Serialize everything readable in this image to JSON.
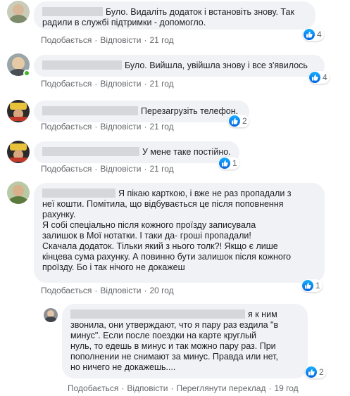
{
  "colors": {
    "bubble_bg": "#f0f2f5",
    "meta_text": "#65676b",
    "like_blue": "#1877f2",
    "online_green": "#42b72a"
  },
  "comments": [
    {
      "text": "Було. Видаліть додаток і встановіть знову. Так\nрадили в службі підтримки - допомогло.",
      "like": "Подобається",
      "reply": "Відповісти",
      "time": "21 год",
      "reactions": "4"
    },
    {
      "text": "Було. Вийшла, увійшла знову і все з'явилось",
      "like": "Подобається",
      "reply": "Відповісти",
      "time": "21 год",
      "reactions": "4"
    },
    {
      "text": "Перезагрузіть телефон.",
      "like": "Подобається",
      "reply": "Відповісти",
      "time": "21 год",
      "reactions": "2"
    },
    {
      "text": "У мене таке постійно.",
      "like": "Подобається",
      "reply": "Відповісти",
      "time": "21 год",
      "reactions": "1"
    },
    {
      "text_first": "Я пікаю карткою, і вже не раз пропадали з",
      "text_rest": "неї кошти. Помітила, що відбувається це після поповнення\nрахунку.\nЯ собі спеціально після кожного проїзду записувала\nзалишок в Мої нотатки. І таки да- гроші пропадали!\nСкачала додаток. Тільки який з нього толк?! Якщо є лише\nкінцева сума рахунку. А повинно бути залишок після кожного\nпроїзду. Бо і так нічого не докажеш",
      "like": "Подобається",
      "reply": "Відповісти",
      "time": "20 год",
      "reactions": "1"
    },
    {
      "text_first": "я к ним",
      "text_rest": "звонила, они утверждают, что я пару раз ездила \"в\nминус\". Если после поездки на карте круглый\nнуль, то едешь в минус и так можно пару раз. При\nпополнении не снимают за минус. Правда или нет,\nно ничего не докажешь....",
      "like": "Подобається",
      "reply": "Відповісти",
      "see_translation": "Переглянути переклад",
      "time": "19 год",
      "reactions": "2"
    }
  ]
}
